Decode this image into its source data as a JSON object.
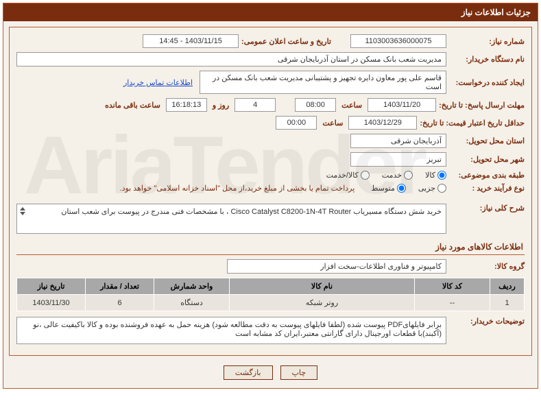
{
  "header": {
    "title": "جزئیات اطلاعات نیاز"
  },
  "labels": {
    "need_no": "شماره نیاز:",
    "announce_dt": "تاریخ و ساعت اعلان عمومی:",
    "buyer_org": "نام دستگاه خریدار:",
    "requester": "ایجاد کننده درخواست:",
    "deadline": "مهلت ارسال پاسخ: تا تاریخ:",
    "validity": "حداقل تاریخ اعتبار قیمت: تا تاریخ:",
    "time": "ساعت",
    "days_and": "روز و",
    "time_left": "ساعت باقی مانده",
    "delivery_province": "استان محل تحویل:",
    "delivery_city": "شهر محل تحویل:",
    "category": "طبقه بندی موضوعی:",
    "buy_type": "نوع فرآیند خرید :",
    "summary": "شرح کلی نیاز:",
    "goods_section": "اطلاعات کالاهای مورد نیاز",
    "group": "گروه کالا:",
    "buyer_notes": "توضیحات خریدار:",
    "contact_link": "اطلاعات تماس خریدار"
  },
  "fields": {
    "need_no": "1103003636000075",
    "announce_dt": "1403/11/15 - 14:45",
    "buyer_org": "مدیریت شعب بانک مسکن در استان آذربایجان شرقی",
    "requester": "قاسم علی پور معاون دایره تجهیز و پشتیبانی مدیریت شعب بانک مسکن در است",
    "deadline_date": "1403/11/20",
    "deadline_time": "08:00",
    "days_left": "4",
    "time_left_clock": "16:18:13",
    "validity_date": "1403/12/29",
    "validity_time": "00:00",
    "province": "آذربایجان شرقی",
    "city": "تبریز",
    "summary": "خرید شش دستگاه مسیریاب Cisco Catalyst C8200-1N-4T Router ، با مشخصات فنی مندرج در پیوست برای شعب استان",
    "group": "کامپیوتر و فناوری اطلاعات-سخت افزار",
    "buyer_notes": "برابر فایلهایPDF پیوست شده (لطفا فایلهای پیوست به دقت مطالعه شود) هزینه حمل به عهده فروشنده بوده و کالا باکیفیت عالی ،نو (آکبند)با قطعات اورجینال دارای گارانتی معتبر،ایران کد مشابه است",
    "note_text": "پرداخت تمام یا بخشی از مبلغ خرید،از محل \"اسناد خزانه اسلامی\" خواهد بود."
  },
  "category_opts": {
    "goods": "کالا",
    "service": "خدمت",
    "goods_service": "کالا/خدمت"
  },
  "buy_type_opts": {
    "partial": "جزیی",
    "medium": "متوسط"
  },
  "table": {
    "headers": {
      "row": "ردیف",
      "code": "کد کالا",
      "name": "نام کالا",
      "unit": "واحد شمارش",
      "qty": "تعداد / مقدار",
      "need_date": "تاریخ نیاز"
    },
    "rows": [
      {
        "row": "1",
        "code": "--",
        "name": "روتر شبکه",
        "unit": "دستگاه",
        "qty": "6",
        "need_date": "1403/11/30"
      }
    ]
  },
  "buttons": {
    "print": "چاپ",
    "back": "بازگشت"
  },
  "watermark": "AriaTender"
}
